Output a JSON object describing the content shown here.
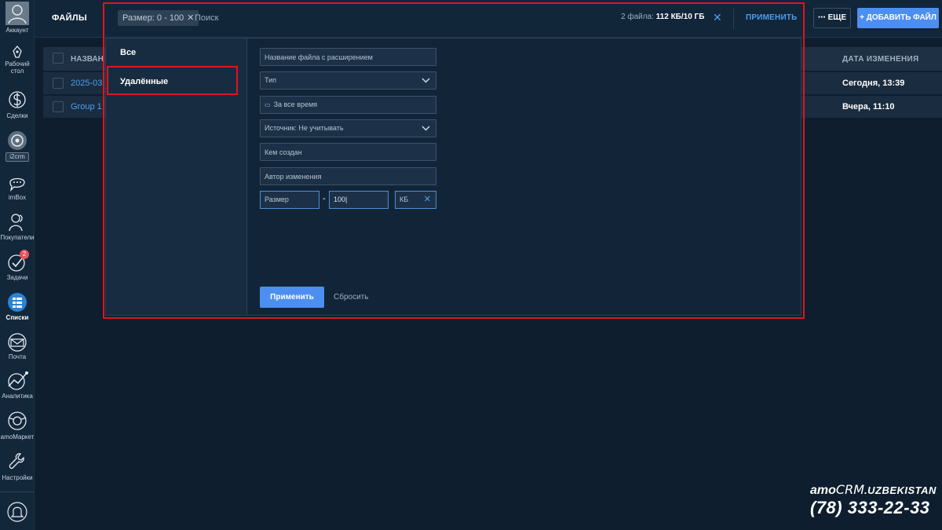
{
  "sidebar": {
    "items": [
      {
        "label": "Аккаунт",
        "icon": "account-icon"
      },
      {
        "label_line1": "Рабочий",
        "label_line2": "стол",
        "icon": "desktop-icon"
      },
      {
        "label": "Сделки",
        "icon": "deals-icon"
      },
      {
        "label": "i2crm",
        "icon": "i2crm-icon"
      },
      {
        "label": "imBox",
        "icon": "imbox-icon"
      },
      {
        "label": "Покупатели",
        "icon": "customers-icon"
      },
      {
        "label": "Задачи",
        "icon": "tasks-icon",
        "badge": "2"
      },
      {
        "label": "Списки",
        "icon": "lists-icon",
        "active": true
      },
      {
        "label": "Почта",
        "icon": "mail-icon"
      },
      {
        "label": "Аналитика",
        "icon": "analytics-icon"
      },
      {
        "label": "amoМаркет",
        "icon": "market-icon"
      },
      {
        "label": "Настройки",
        "icon": "settings-icon"
      },
      {
        "label": "",
        "icon": "bell-icon"
      }
    ]
  },
  "header": {
    "title": "ФАЙЛЫ",
    "filter_chip": "Размер: 0 - 100",
    "search_placeholder": "Поиск",
    "files_count": "2 файла:",
    "files_size": "112 КБ/10 ГБ",
    "apply_label": "ПРИМЕНИТЬ",
    "more_label": "ЕЩЕ",
    "add_file_label": "+ ДОБАВИТЬ ФАЙЛ"
  },
  "table": {
    "columns": {
      "name": "НАЗВАН",
      "date": "ДАТА ИЗМЕНЕНИЯ"
    },
    "rows": [
      {
        "name": "2025-03",
        "date": "Сегодня, 13:39"
      },
      {
        "name": "Group 1",
        "date": "Вчера, 11:10"
      }
    ]
  },
  "filter": {
    "presets": [
      "Все",
      "Удалённые"
    ],
    "fields": {
      "file_name": "Название файла с расширением",
      "type": "Тип",
      "period": "За все время",
      "source": "Источник: Не учитывать",
      "created_by": "Кем создан",
      "modified_by": "Автор изменения",
      "size_placeholder": "Размер",
      "size_value": "100",
      "size_unit": "КБ"
    },
    "apply_label": "Применить",
    "reset_label": "Сбросить"
  },
  "watermark": {
    "brand_amo": "amo",
    "brand_crm": "CRM",
    "brand_suffix": ".UZBEKISTAN",
    "phone": "(78) 333-22-33"
  },
  "colors": {
    "accent": "#4c8ff0",
    "highlight": "#e0141d",
    "background": "#0e1e2f"
  }
}
